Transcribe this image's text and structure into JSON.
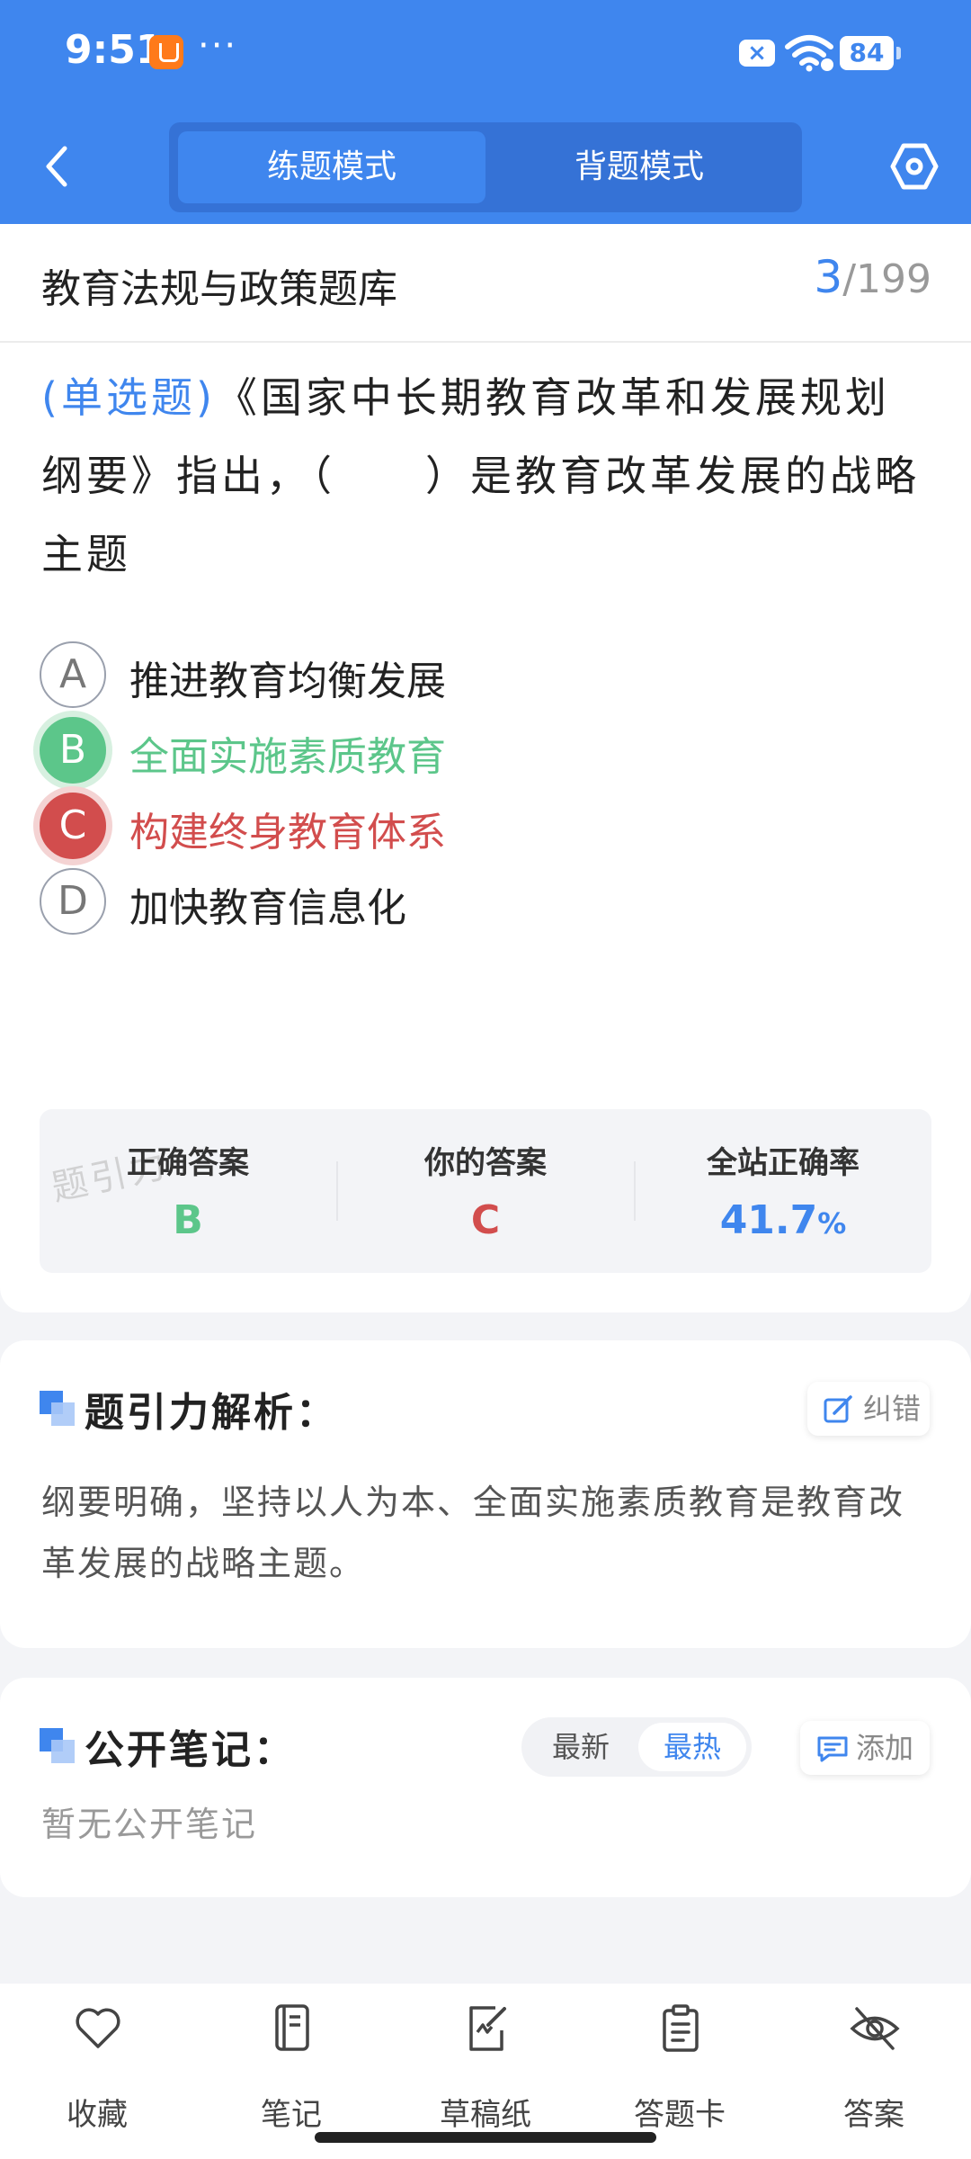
{
  "status_bar": {
    "time": "9:51",
    "more": "···",
    "battery": "84"
  },
  "header": {
    "modes": [
      "练题模式",
      "背题模式"
    ],
    "active_mode": "练题模式"
  },
  "question": {
    "bank_title": "教育法规与政策题库",
    "current": "3",
    "total": "/199",
    "type": "(单选题)",
    "text": "《国家中长期教育改革和发展规划纲要》指出，（　　）是教育改革发展的战略主题",
    "options": [
      {
        "letter": "A",
        "text": "推进教育均衡发展",
        "state": "normal"
      },
      {
        "letter": "B",
        "text": "全面实施素质教育",
        "state": "correct"
      },
      {
        "letter": "C",
        "text": "构建终身教育体系",
        "state": "wrong"
      },
      {
        "letter": "D",
        "text": "加快教育信息化",
        "state": "normal"
      }
    ]
  },
  "stats": {
    "watermark": "题引力",
    "correct_label": "正确答案",
    "correct_value": "B",
    "yours_label": "你的答案",
    "yours_value": "C",
    "rate_label": "全站正确率",
    "rate_value": "41.7",
    "rate_unit": "%"
  },
  "analysis": {
    "title": "题引力解析：",
    "report_label": "纠错",
    "text": "纲要明确，坚持以人为本、全面实施素质教育是教育改革发展的战略主题。"
  },
  "notes": {
    "title": "公开笔记：",
    "sort_options": [
      "最新",
      "最热"
    ],
    "active_sort": "最热",
    "add_label": "添加",
    "empty_text": "暂无公开笔记"
  },
  "bottom_nav": [
    "收藏",
    "笔记",
    "草稿纸",
    "答题卡",
    "答案"
  ],
  "colors": {
    "primary": "#3f86ee",
    "correct": "#5cc68a",
    "wrong": "#d24d4d"
  }
}
